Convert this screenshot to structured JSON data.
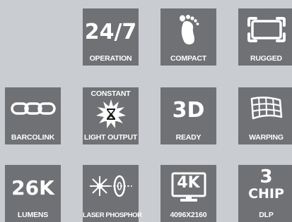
{
  "features": [
    {
      "id": "operation",
      "value": "24/7",
      "label": "OPERATION",
      "icon": null
    },
    {
      "id": "compact",
      "value": null,
      "label": "COMPACT",
      "icon": "footprint-icon"
    },
    {
      "id": "rugged",
      "value": null,
      "label": "RUGGED",
      "icon": "rugged-frame-icon"
    },
    {
      "id": "barcolink",
      "value": null,
      "label": "BARCOLINK",
      "icon": "chain-link-icon"
    },
    {
      "id": "constant-light",
      "value": "CONSTANT",
      "label": "LIGHT OUTPUT",
      "icon": "hourglass-burst-icon"
    },
    {
      "id": "ready-3d",
      "value": "3D",
      "label": "READY",
      "icon": null
    },
    {
      "id": "warping",
      "value": null,
      "label": "WARPING",
      "icon": "warped-grid-icon"
    },
    {
      "id": "lumens",
      "value": "26K",
      "label": "LUMENS",
      "icon": null
    },
    {
      "id": "laser-phosphor",
      "value": null,
      "label": "LASER PHOSPHOR",
      "icon": "laser-disc-icon"
    },
    {
      "id": "resolution",
      "value": "4K",
      "label": "4096X2160",
      "icon": "monitor-icon"
    },
    {
      "id": "chip",
      "value": "3",
      "value2": "CHIP",
      "label": "DLP",
      "icon": null
    }
  ],
  "colors": {
    "tile": "#6f7175",
    "background": "#c9ccd1",
    "foreground": "#ffffff"
  }
}
